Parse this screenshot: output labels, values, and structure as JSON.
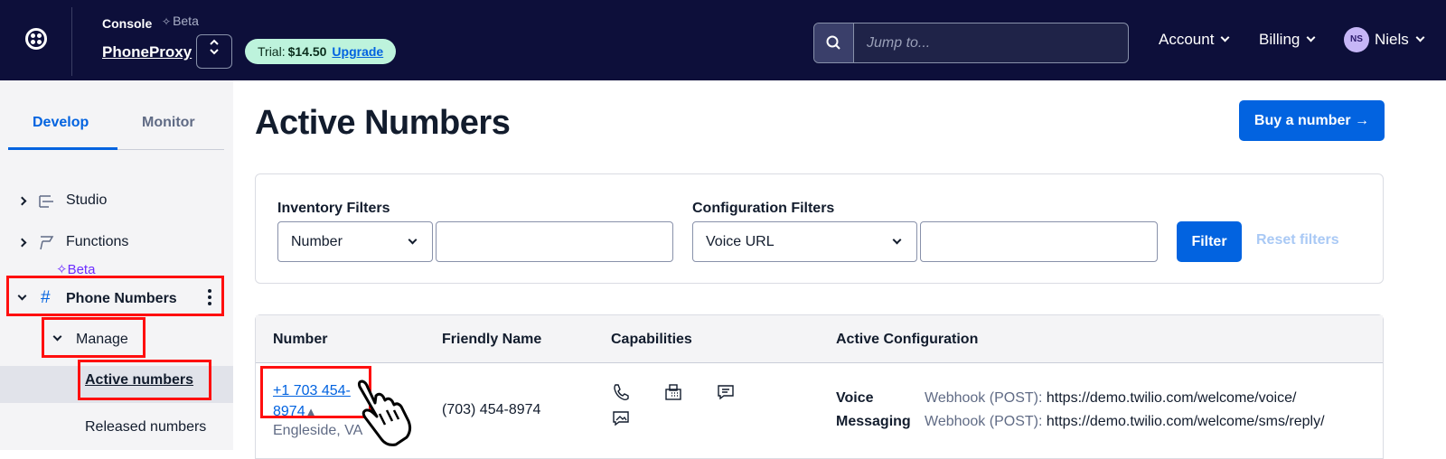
{
  "topbar": {
    "console": "Console",
    "beta": "Beta",
    "project": "PhoneProxy",
    "trial_label": "Trial:",
    "trial_amount": "$14.50",
    "upgrade": "Upgrade",
    "search_placeholder": "Jump to...",
    "account": "Account",
    "billing": "Billing",
    "avatar_initials": "NS",
    "user_name": "Niels"
  },
  "sidebar": {
    "tabs": [
      {
        "label": "Develop"
      },
      {
        "label": "Monitor"
      }
    ],
    "items": [
      {
        "label": "Studio"
      },
      {
        "label": "Functions",
        "badge": "Beta"
      },
      {
        "label": "Phone Numbers"
      },
      {
        "label": "Manage"
      },
      {
        "label": "Active numbers"
      },
      {
        "label": "Released numbers"
      }
    ]
  },
  "main": {
    "title": "Active Numbers",
    "buy_button": "Buy a number →",
    "filters": {
      "inventory_label": "Inventory Filters",
      "inventory_select": "Number",
      "config_label": "Configuration Filters",
      "config_select": "Voice URL",
      "filter_button": "Filter",
      "reset": "Reset filters"
    },
    "table": {
      "headers": [
        "Number",
        "Friendly Name",
        "Capabilities",
        "Active Configuration"
      ],
      "rows": [
        {
          "number": "+1 703 454-8974",
          "location": "Engleside, VA",
          "friendly_name": "(703) 454-8974",
          "voice_label": "Voice",
          "voice_method": "Webhook (POST):",
          "voice_url": "https://demo.twilio.com/welcome/voice/",
          "messaging_label": "Messaging",
          "messaging_method": "Webhook (POST):",
          "messaging_url": "https://demo.twilio.com/welcome/sms/reply/"
        }
      ]
    }
  },
  "colors": {
    "topbar_bg": "#0d0f3a",
    "accent_blue": "#0263e0",
    "highlight_red": "#ff0f0f",
    "trial_green": "#bdf3dc"
  },
  "icons": [
    "twilio-logo-icon",
    "search-icon",
    "studio-icon",
    "functions-icon",
    "hash-icon",
    "phone-icon",
    "fax-icon",
    "sms-icon",
    "mms-icon",
    "hand-cursor-icon"
  ]
}
